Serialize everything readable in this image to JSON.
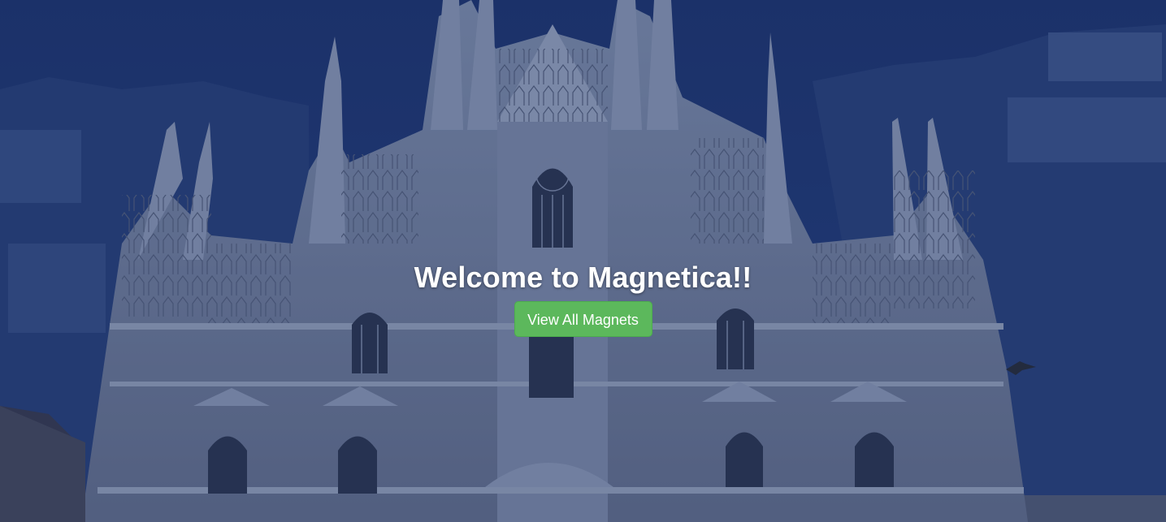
{
  "hero": {
    "heading": "Welcome to Magnetica!!",
    "button_label": "View All Magnets"
  },
  "colors": {
    "button": "#5cb85c",
    "overlay": "#1d2f5c",
    "heading": "#ffffff"
  }
}
